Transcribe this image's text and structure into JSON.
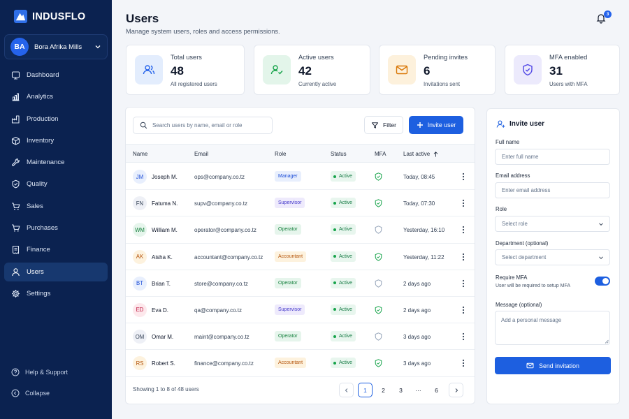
{
  "app": {
    "name": "INDUSFLO"
  },
  "org": {
    "initials": "BA",
    "name": "Bora Afrika Mills"
  },
  "nav": [
    {
      "label": "Dashboard",
      "icon": "dashboard-icon"
    },
    {
      "label": "Analytics",
      "icon": "analytics-icon"
    },
    {
      "label": "Production",
      "icon": "factory-icon"
    },
    {
      "label": "Inventory",
      "icon": "box-icon"
    },
    {
      "label": "Maintenance",
      "icon": "wrench-icon"
    },
    {
      "label": "Quality",
      "icon": "shield-check-icon"
    },
    {
      "label": "Sales",
      "icon": "cart-icon"
    },
    {
      "label": "Purchases",
      "icon": "cart-icon"
    },
    {
      "label": "Finance",
      "icon": "receipt-icon"
    },
    {
      "label": "Users",
      "icon": "user-icon",
      "active": true
    },
    {
      "label": "Settings",
      "icon": "gear-icon"
    }
  ],
  "sidebar_bottom": {
    "help": "Help & Support",
    "collapse": "Collapse"
  },
  "header": {
    "title": "Users",
    "subtitle": "Manage system users, roles and access permissions.",
    "notifications": "3"
  },
  "stats": [
    {
      "label": "Total users",
      "value": "48",
      "caption": "All registered users",
      "icon": "users-icon"
    },
    {
      "label": "Active users",
      "value": "42",
      "caption": "Currently active",
      "icon": "user-check-icon"
    },
    {
      "label": "Pending invites",
      "value": "6",
      "caption": "Invitations sent",
      "icon": "mail-icon"
    },
    {
      "label": "MFA enabled",
      "value": "31",
      "caption": "Users with MFA",
      "icon": "shield-check-icon"
    }
  ],
  "toolbar": {
    "search_placeholder": "Search users by name, email or role",
    "filter_label": "Filter",
    "invite_label": "Invite user"
  },
  "table": {
    "columns": [
      "Name",
      "Email",
      "Role",
      "Status",
      "MFA",
      "Last active"
    ],
    "rows": [
      {
        "initials": "JM",
        "name": "Joseph M.",
        "email": "ops@company.co.tz",
        "role": "Manager",
        "status": "Active",
        "mfa": true,
        "last_active": "Today, 08:45"
      },
      {
        "initials": "FN",
        "name": "Fatuma N.",
        "email": "supv@company.co.tz",
        "role": "Supervisor",
        "status": "Active",
        "mfa": true,
        "last_active": "Today, 07:30"
      },
      {
        "initials": "WM",
        "name": "William M.",
        "email": "operator@company.co.tz",
        "role": "Operator",
        "status": "Active",
        "mfa": false,
        "last_active": "Yesterday, 16:10"
      },
      {
        "initials": "AK",
        "name": "Aisha K.",
        "email": "accountant@company.co.tz",
        "role": "Accountant",
        "status": "Active",
        "mfa": true,
        "last_active": "Yesterday, 11:22"
      },
      {
        "initials": "BT",
        "name": "Brian T.",
        "email": "store@company.co.tz",
        "role": "Operator",
        "status": "Active",
        "mfa": false,
        "last_active": "2 days ago"
      },
      {
        "initials": "ED",
        "name": "Eva D.",
        "email": "qa@company.co.tz",
        "role": "Supervisor",
        "status": "Active",
        "mfa": true,
        "last_active": "2 days ago"
      },
      {
        "initials": "OM",
        "name": "Omar M.",
        "email": "maint@company.co.tz",
        "role": "Operator",
        "status": "Active",
        "mfa": false,
        "last_active": "3 days ago"
      },
      {
        "initials": "RS",
        "name": "Robert S.",
        "email": "finance@company.co.tz",
        "role": "Accountant",
        "status": "Active",
        "mfa": true,
        "last_active": "3 days ago"
      }
    ]
  },
  "pagination": {
    "info": "Showing 1 to 8 of 48 users",
    "pages": [
      "1",
      "2",
      "3",
      "···",
      "6"
    ],
    "current": "1"
  },
  "invite_form": {
    "title": "Invite user",
    "full_name_label": "Full name",
    "full_name_placeholder": "Enter full name",
    "email_label": "Email address",
    "email_placeholder": "Enter email address",
    "role_label": "Role",
    "role_placeholder": "Select role",
    "department_label": "Department (optional)",
    "department_placeholder": "Select department",
    "mfa_label": "Require MFA",
    "mfa_help": "User will be required to setup MFA",
    "mfa_enabled": true,
    "message_label": "Message (optional)",
    "message_placeholder": "Add a personal message",
    "send_label": "Send invitation"
  },
  "colors": {
    "sidebar": "#0b2250",
    "primary": "#1d5fe0",
    "active_green": "#16a34a"
  }
}
